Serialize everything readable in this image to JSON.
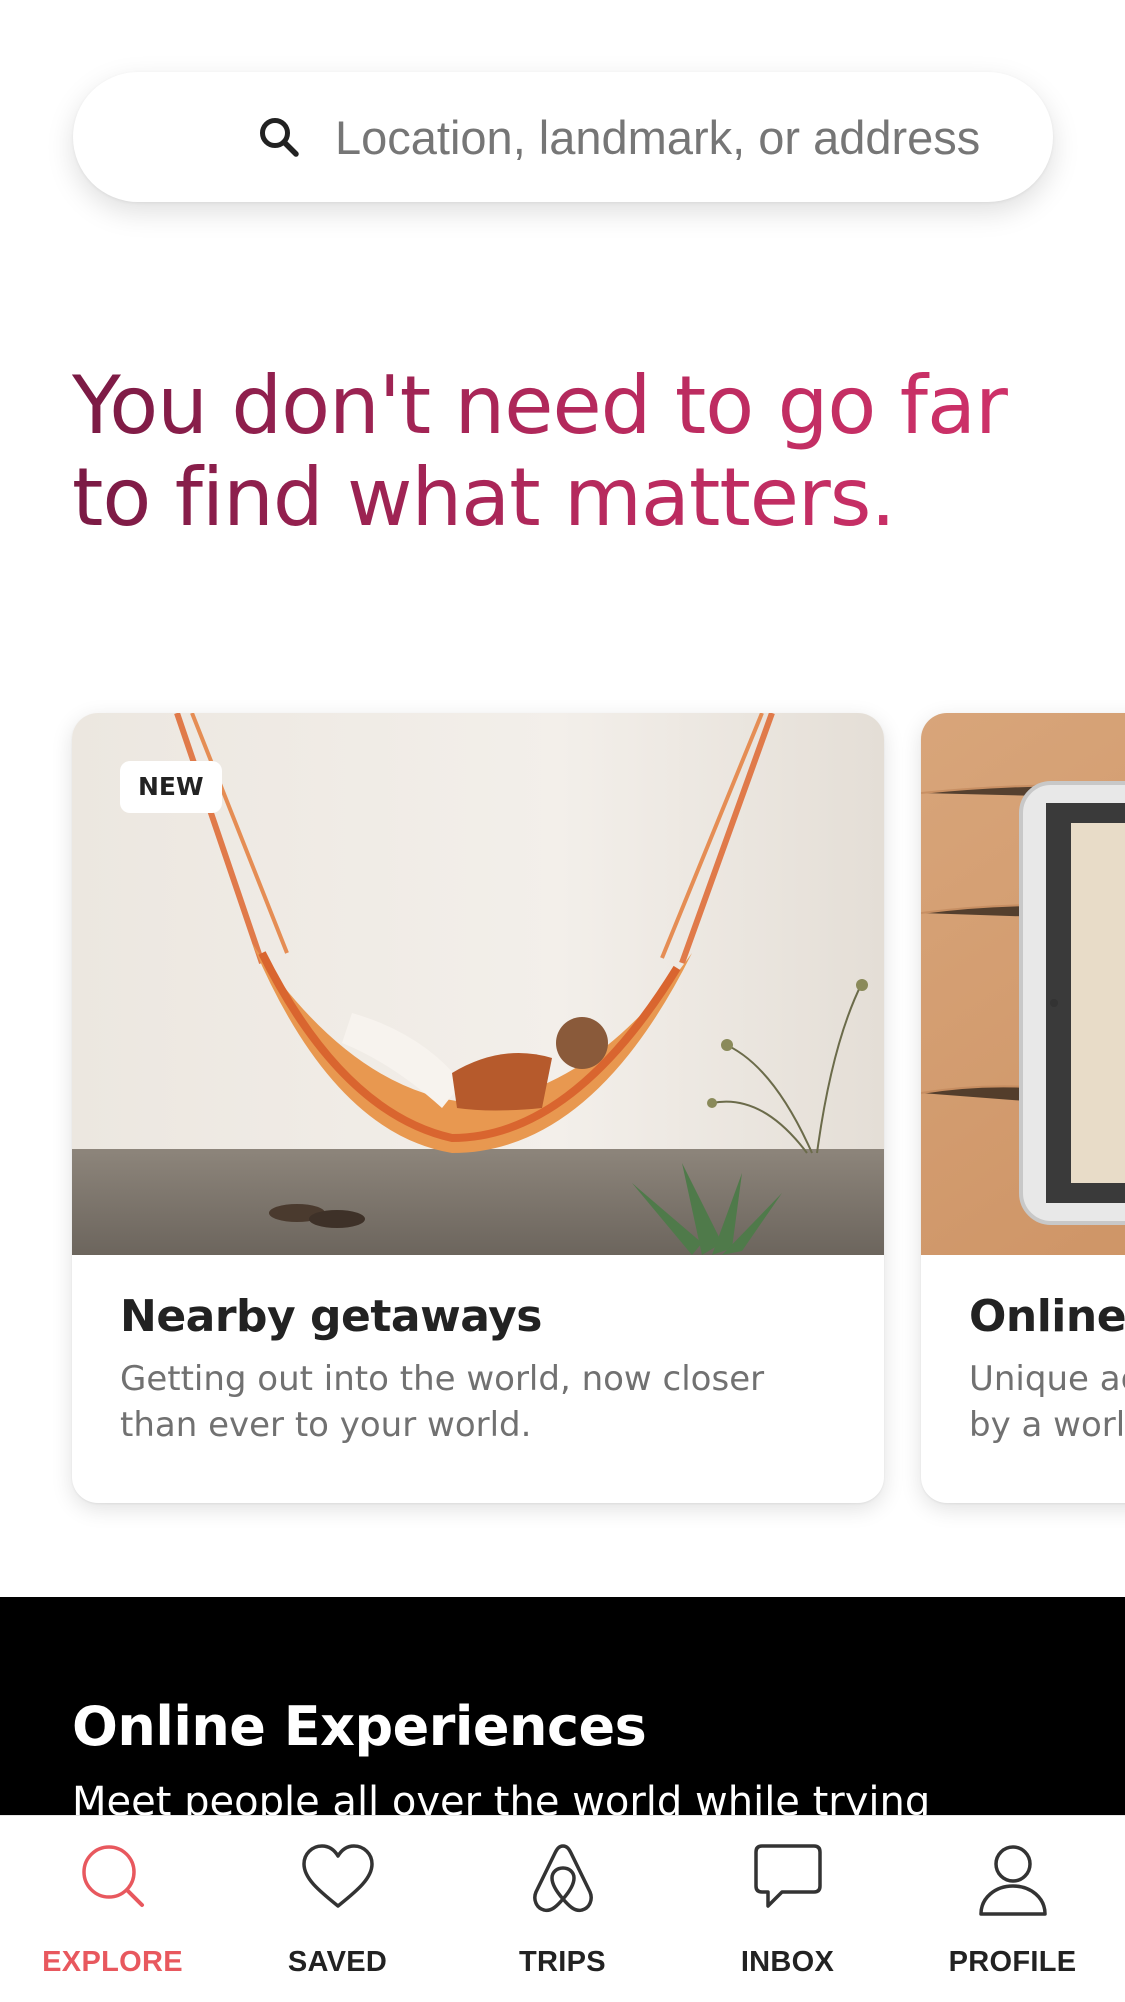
{
  "search": {
    "placeholder": "Location, landmark, or address",
    "icon": "search-icon"
  },
  "headline": {
    "line1": "You don't need to go far",
    "line2": "to find what matters."
  },
  "cards": [
    {
      "badge": "NEW",
      "title": "Nearby getaways",
      "desc_line1": "Getting out into the world, now closer",
      "desc_line2": "than ever to your world."
    },
    {
      "title": "Online",
      "desc_line1": "Unique ac",
      "desc_line2": "by a world"
    }
  ],
  "experiences": {
    "title": "Online Experiences",
    "description": "Meet people all over the world while trying"
  },
  "nav": {
    "active_color": "#e8585e",
    "items": [
      {
        "label": "EXPLORE",
        "icon": "search-icon",
        "active": true
      },
      {
        "label": "SAVED",
        "icon": "heart-icon"
      },
      {
        "label": "TRIPS",
        "icon": "airbnb-logo-icon"
      },
      {
        "label": "INBOX",
        "icon": "chat-bubble-icon"
      },
      {
        "label": "PROFILE",
        "icon": "person-icon"
      }
    ]
  }
}
